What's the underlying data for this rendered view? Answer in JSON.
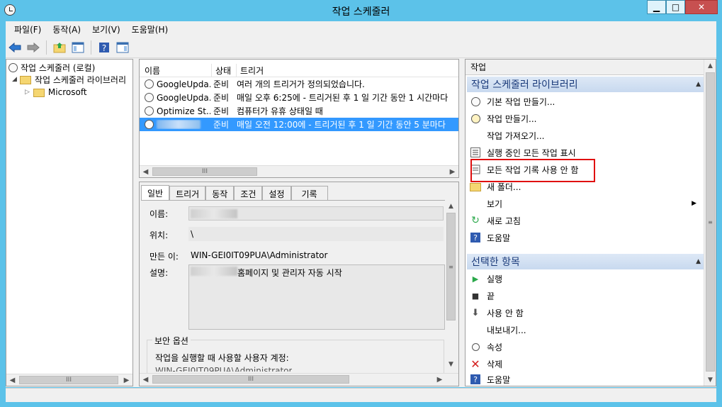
{
  "window": {
    "title": "작업 스케줄러"
  },
  "window_controls": {
    "minimize": "▁",
    "maximize": "□",
    "close": "✕"
  },
  "menu": [
    {
      "label": "파일(F)"
    },
    {
      "label": "동작(A)"
    },
    {
      "label": "보기(V)"
    },
    {
      "label": "도움말(H)"
    }
  ],
  "toolbar": {
    "icons": [
      "back-arrow-icon",
      "forward-arrow-icon",
      "up-folder-icon",
      "show-hide-tree-icon",
      "help-icon",
      "show-hide-action-pane-icon"
    ]
  },
  "tree": {
    "root": "작업 스케줄러 (로컬)",
    "library": "작업 스케줄러 라이브러리",
    "child": "Microsoft",
    "scroll_glyph": "III"
  },
  "task_list": {
    "columns": [
      "이름",
      "상태",
      "트리거"
    ],
    "rows": [
      {
        "name": "GoogleUpda...",
        "status": "준비",
        "trigger": "여러 개의 트리거가 정의되었습니다."
      },
      {
        "name": "GoogleUpda...",
        "status": "준비",
        "trigger": "매일 오후 6:25에 - 트리거된 후 1 일 기간 동안 1 시간마다"
      },
      {
        "name": "Optimize St...",
        "status": "준비",
        "trigger": "컴퓨터가 유휴 상태일 때"
      },
      {
        "name": "",
        "status": "준비",
        "trigger": "매일 오전 12:00에 - 트리거된 후 1 일 기간 동안 5 분마다",
        "selected": true
      }
    ],
    "scroll_glyph": "III"
  },
  "detail": {
    "tabs": [
      "일반",
      "트리거",
      "동작",
      "조건",
      "설정",
      "기록"
    ],
    "active_tab": "일반",
    "labels": {
      "name": "이름:",
      "location": "위치:",
      "author": "만든 이:",
      "description": "설명:"
    },
    "values": {
      "location": "\\",
      "author": "WIN-GEI0IT09PUA\\Administrator",
      "description": "홈페이지 및 관리자 자동 시작"
    },
    "security_group": "보안 옵션",
    "run_as_label": "작업을 실행할 때 사용할 사용자 계정:",
    "run_as_value": "WIN-GEI0IT09PUA\\Administrator",
    "scroll_glyph": "III"
  },
  "actions": {
    "header": "작업",
    "sections": [
      {
        "title": "작업 스케줄러 라이브러리",
        "items": [
          {
            "label": "기본 작업 만들기...",
            "icon": "create-basic-task-icon"
          },
          {
            "label": "작업 만들기...",
            "icon": "create-task-icon"
          },
          {
            "label": "작업 가져오기...",
            "icon": ""
          },
          {
            "label": "실행 중인 모든 작업 표시",
            "icon": "running-tasks-icon"
          },
          {
            "label": "모든 작업 기록 사용 안 함",
            "icon": "disable-history-icon"
          },
          {
            "label": "새 폴더...",
            "icon": "new-folder-icon"
          },
          {
            "label": "보기",
            "icon": "",
            "submenu": "▶"
          },
          {
            "label": "새로 고침",
            "icon": "refresh-icon"
          },
          {
            "label": "도움말",
            "icon": "help-icon"
          }
        ]
      },
      {
        "title": "선택한 항목",
        "items": [
          {
            "label": "실행",
            "icon": "run-icon"
          },
          {
            "label": "끝",
            "icon": "end-icon"
          },
          {
            "label": "사용 안 함",
            "icon": "disable-icon"
          },
          {
            "label": "내보내기...",
            "icon": ""
          },
          {
            "label": "속성",
            "icon": "properties-icon"
          },
          {
            "label": "삭제",
            "icon": "delete-icon"
          },
          {
            "label": "도움말",
            "icon": "help-icon"
          }
        ]
      }
    ]
  },
  "colors": {
    "accent": "#3399ff",
    "highlight_box": "#e01010",
    "title_bar": "#5cc2e9",
    "section_text": "#1a3a7a"
  }
}
